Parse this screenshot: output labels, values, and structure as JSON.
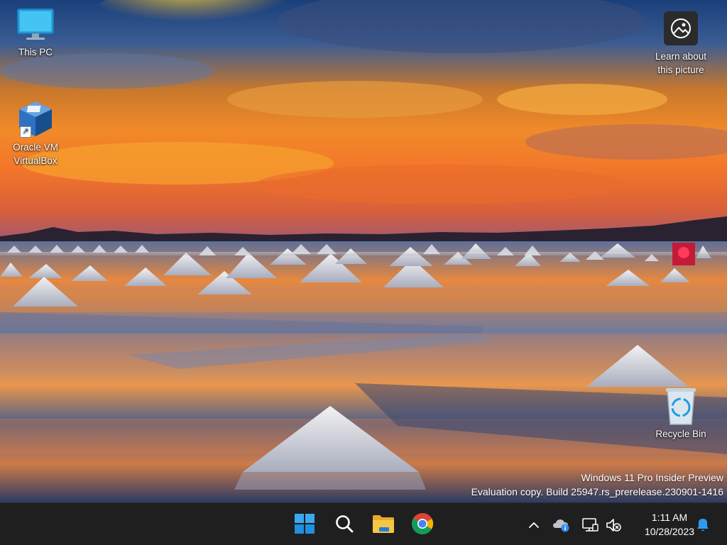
{
  "desktop": {
    "icons": [
      {
        "label": "This PC",
        "icon": "monitor-icon"
      },
      {
        "label": "Oracle VM\nVirtualBox",
        "icon": "virtualbox-icon"
      },
      {
        "label": "Learn about\nthis picture",
        "icon": "camera-icon"
      },
      {
        "label": "Recycle Bin",
        "icon": "recycle-bin-icon"
      }
    ]
  },
  "watermark": {
    "line1": "Windows 11 Pro Insider Preview",
    "line2": "Evaluation copy. Build 25947.rs_prerelease.230901-1416"
  },
  "taskbar": {
    "apps": [
      {
        "name": "Start",
        "icon": "windows-logo-icon"
      },
      {
        "name": "Search",
        "icon": "search-icon"
      },
      {
        "name": "File Explorer",
        "icon": "folder-icon"
      },
      {
        "name": "Google Chrome",
        "icon": "chrome-icon"
      }
    ],
    "tray": {
      "icons": [
        "chevron-up-icon",
        "onedrive-icon",
        "network-icon",
        "volume-muted-icon",
        "notification-bell-icon"
      ]
    },
    "clock": {
      "time": "1:11 AM",
      "date": "10/28/2023"
    }
  },
  "colors": {
    "taskbar_bg": "#1f1f1f",
    "accent_blue": "#1e90ff",
    "tray_badge": "#2f8cf0"
  }
}
